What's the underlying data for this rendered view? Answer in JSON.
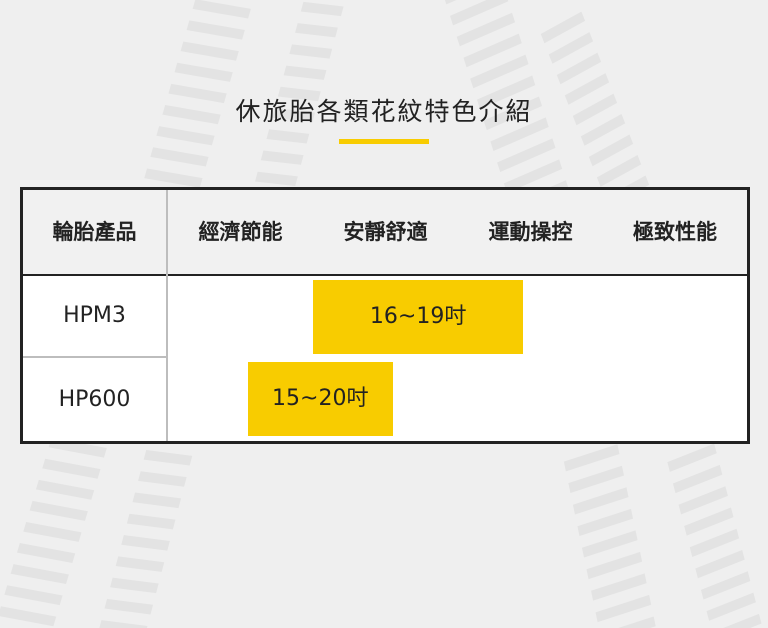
{
  "title": "休旅胎各類花紋特色介紹",
  "colors": {
    "accent": "#f8cc00",
    "border": "#222222",
    "header_bg": "#f1f1f1",
    "page_bg": "#efefef"
  },
  "table": {
    "corner_label": "輪胎產品",
    "columns": [
      "經濟節能",
      "安靜舒適",
      "運動操控",
      "極致性能"
    ],
    "rows": [
      "HPM3",
      "HP600"
    ]
  },
  "chart_data": {
    "type": "table",
    "categories": [
      "經濟節能",
      "安靜舒適",
      "運動操控",
      "極致性能"
    ],
    "rows": [
      {
        "product": "HPM3",
        "label": "16~19吋",
        "start": 1.0,
        "end": 2.45
      },
      {
        "product": "HP600",
        "label": "15~20吋",
        "start": 0.55,
        "end": 1.55
      }
    ]
  }
}
